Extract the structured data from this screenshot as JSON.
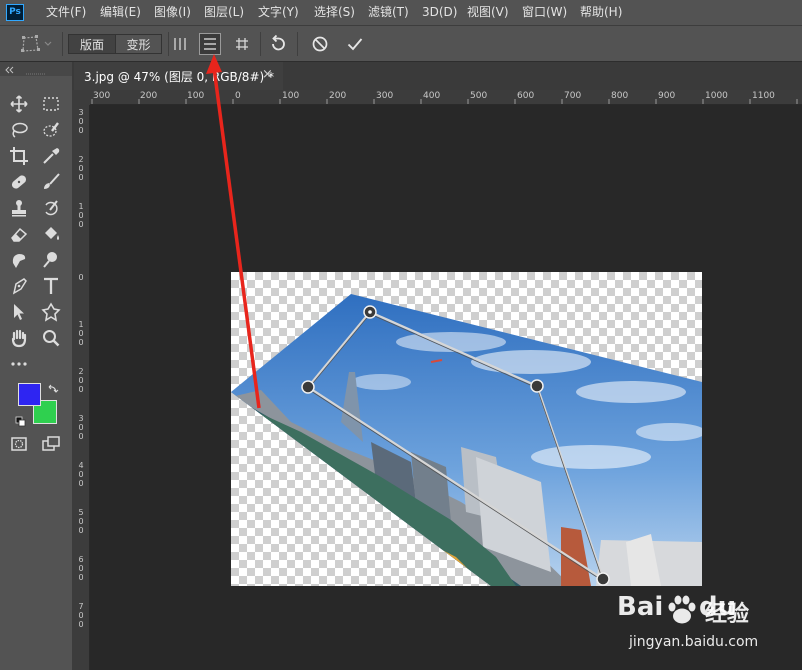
{
  "app": {
    "logo_text": "Ps"
  },
  "menu": [
    "文件(F)",
    "编辑(E)",
    "图像(I)",
    "图层(L)",
    "文字(Y)",
    "选择(S)",
    "滤镜(T)",
    "3D(D)",
    "视图(V)",
    "窗口(W)",
    "帮助(H)"
  ],
  "options_bar": {
    "mode_options": [
      "版面",
      "变形"
    ],
    "selected_mode": "版面",
    "vertical_guides_icon": "vertical-lines-icon",
    "horizontal_guides_icon": "horizontal-lines-icon",
    "grid_icon": "hash-grid-icon",
    "undo_icon": "rotate-undo-icon",
    "cancel_icon": "cancel-circle-icon",
    "commit_icon": "checkmark-icon"
  },
  "document": {
    "tab_label": "3.jpg @ 47% (图层 0, RGB/8#) *",
    "close_label": "×"
  },
  "ruler": {
    "h_labels": [
      "300",
      "200",
      "100",
      "0",
      "100",
      "200",
      "300",
      "400",
      "500",
      "600",
      "700",
      "800",
      "900",
      "1000",
      "1100"
    ],
    "v_labels": [
      "300",
      "200",
      "100",
      "0",
      "100",
      "200",
      "300",
      "400",
      "500",
      "600",
      "700"
    ]
  },
  "colors": {
    "foreground": "#2e25f2",
    "background": "#2fd04f",
    "annotation_arrow": "#e8251c"
  },
  "watermark": {
    "logo": "Bai du",
    "jingyan": "经验",
    "url": "jingyan.baidu.com"
  }
}
